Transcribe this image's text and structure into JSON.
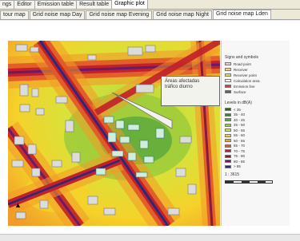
{
  "top_tabs": [
    "ngs",
    "Editor",
    "Emission table",
    "Result table",
    "Graphic plot"
  ],
  "top_active": 4,
  "sub_tabs": [
    "tour map",
    "Grid noise map Day",
    "Grid noise map Evening",
    "Grid noise map Night",
    "Grid noise map Lden"
  ],
  "sub_active": 4,
  "annotation": {
    "line1": "Áreas afectadas",
    "line2": "tráfico diurno"
  },
  "legend": {
    "signs_title": "Signs and symbols",
    "signs": [
      {
        "label": "Road point",
        "color": "#e8c8e8"
      },
      {
        "label": "Receiver",
        "color": "#f0d080"
      },
      {
        "label": "Receiver point",
        "color": "#e0e060"
      },
      {
        "label": "Calculation area",
        "color": "#ffffff"
      },
      {
        "label": "Emission line",
        "color": "#d04040"
      },
      {
        "label": "Surface",
        "color": "#606060"
      }
    ],
    "levels_title": "Levels in dB(A)",
    "levels": [
      {
        "label": "< 35",
        "color": "#1a6e1a"
      },
      {
        "label": "35 - 40",
        "color": "#2d8c2d"
      },
      {
        "label": "40 - 45",
        "color": "#5aa83c"
      },
      {
        "label": "45 - 50",
        "color": "#9ccb3b"
      },
      {
        "label": "50 - 55",
        "color": "#d8e23a"
      },
      {
        "label": "55 - 60",
        "color": "#f5d22a"
      },
      {
        "label": "60 - 65",
        "color": "#f29b28"
      },
      {
        "label": "65 - 70",
        "color": "#e2562a"
      },
      {
        "label": "70 - 75",
        "color": "#c2202a"
      },
      {
        "label": "75 - 80",
        "color": "#8a1a3a"
      },
      {
        "label": "80 - 85",
        "color": "#6a1a6a"
      },
      {
        "label": "> 85",
        "color": "#2a2a7a"
      }
    ],
    "scale": "1 : 3615"
  },
  "north_label": "N"
}
